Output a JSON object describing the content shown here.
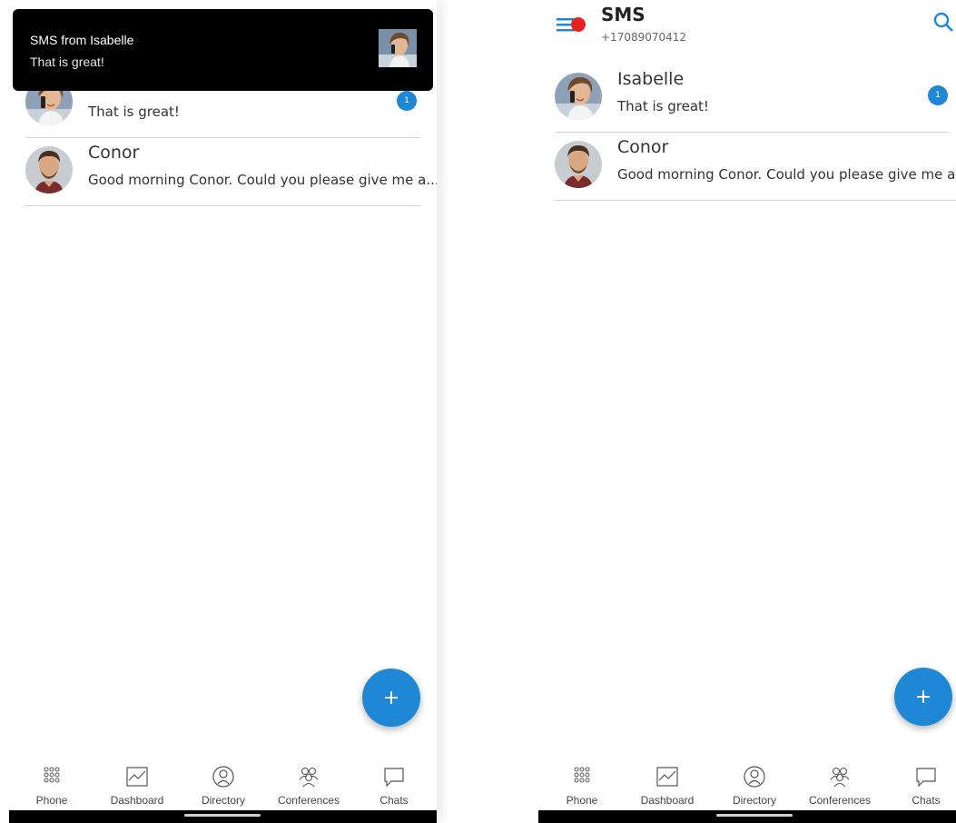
{
  "notification": {
    "title": "SMS from Isabelle",
    "body": "That is great!"
  },
  "header": {
    "title": "SMS",
    "subtitle": "+17089070412"
  },
  "conversations": [
    {
      "name": "Isabelle",
      "preview": "That is great!",
      "unread": "1"
    },
    {
      "name": "Conor",
      "preview_truncated": "Good morning Conor. Could you please give me a...",
      "preview": "Good morning Conor. Could you please give me a"
    }
  ],
  "nav": {
    "phone": "Phone",
    "dashboard": "Dashboard",
    "directory": "Directory",
    "conferences": "Conferences",
    "chats": "Chats"
  },
  "icons": {
    "menu": "menu-icon",
    "search": "search-icon",
    "add": "plus-icon"
  },
  "colors": {
    "accent": "#1e88d6",
    "notification_dot": "#e52222",
    "notification_bg": "#000000"
  }
}
